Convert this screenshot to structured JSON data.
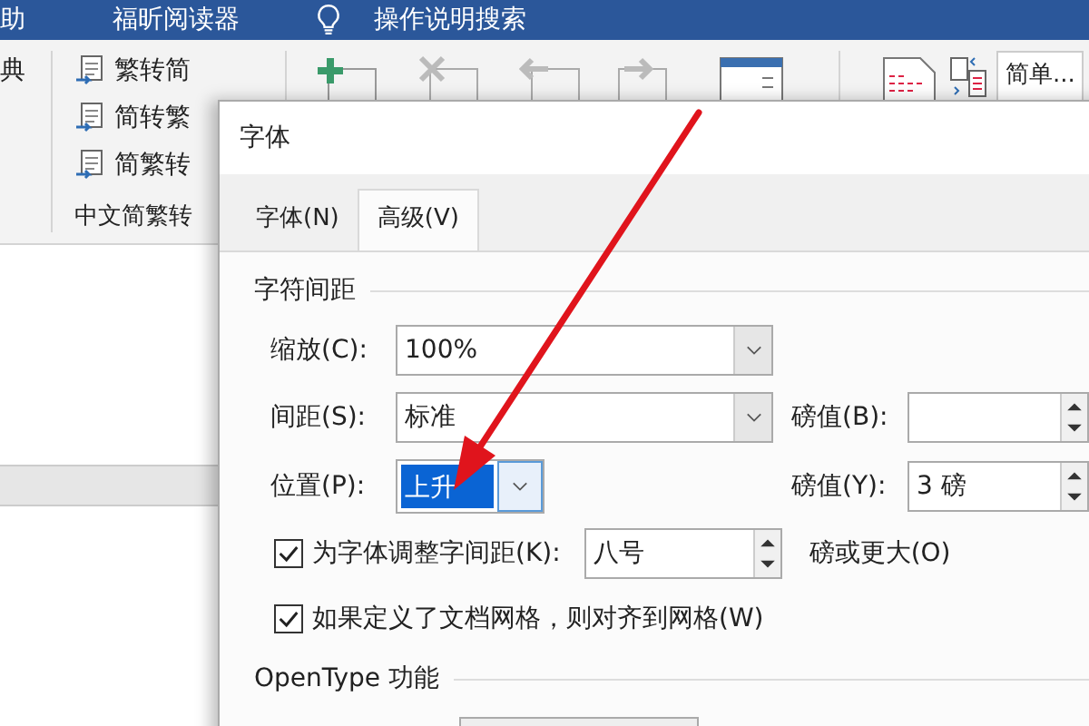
{
  "top_bar": {
    "items": [
      {
        "label": "助",
        "kind": "text"
      },
      {
        "label": "福昕阅读器",
        "kind": "text"
      },
      {
        "label": "操作说明搜索",
        "kind": "search"
      }
    ]
  },
  "ribbon": {
    "cut_label": "典",
    "convert_items": [
      {
        "label": "繁转简"
      },
      {
        "label": "简转繁"
      },
      {
        "label": "简繁转"
      }
    ],
    "group_label": "中文简繁转",
    "style_field": {
      "value": "简单..."
    }
  },
  "dialog": {
    "title": "字体",
    "tabs": [
      {
        "label": "字体(N)",
        "selected": false
      },
      {
        "label": "高级(V)",
        "selected": true
      }
    ],
    "spacing_section": {
      "title": "字符间距",
      "scale": {
        "label": "缩放(C):",
        "value": "100%"
      },
      "spacing": {
        "label": "间距(S):",
        "value": "标准",
        "points_label": "磅值(B):"
      },
      "position": {
        "label": "位置(P):",
        "value": "上升",
        "selected": true,
        "points_label": "磅值(Y):",
        "points_value": "3 磅"
      },
      "kerning": {
        "label": "为字体调整字间距(K):",
        "checked": true,
        "value": "八号",
        "suffix": "磅或更大(O)"
      },
      "snap_grid": {
        "label": "如果定义了文档网格，则对齐到网格(W)",
        "checked": true
      }
    },
    "opentype_section": {
      "title": "OpenType 功能"
    }
  }
}
